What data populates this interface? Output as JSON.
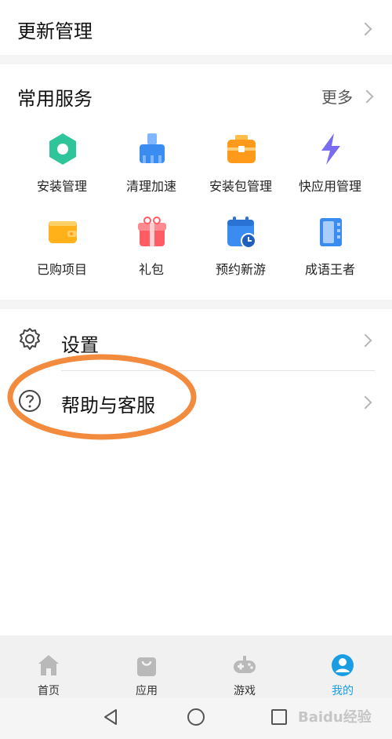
{
  "update": {
    "label": "更新管理"
  },
  "services": {
    "title": "常用服务",
    "more": "更多",
    "items": [
      {
        "label": "安装管理",
        "icon": "install-manage-icon",
        "color": "#2ec59a"
      },
      {
        "label": "清理加速",
        "icon": "broom-icon",
        "color": "#3b8cf0"
      },
      {
        "label": "安装包管理",
        "icon": "package-icon",
        "color": "#ff9a1a"
      },
      {
        "label": "快应用管理",
        "icon": "lightning-icon",
        "color": "#7a6cf0"
      },
      {
        "label": "已购项目",
        "icon": "wallet-icon",
        "color": "#ffb11a"
      },
      {
        "label": "礼包",
        "icon": "gift-icon",
        "color": "#ff5c63"
      },
      {
        "label": "预约新游",
        "icon": "calendar-icon",
        "color": "#3b8cf0"
      },
      {
        "label": "成语王者",
        "icon": "book-icon",
        "color": "#3b8cf0"
      }
    ]
  },
  "settings": {
    "label": "设置"
  },
  "help": {
    "label": "帮助与客服"
  },
  "tabbar": {
    "items": [
      {
        "label": "首页",
        "icon": "home-icon"
      },
      {
        "label": "应用",
        "icon": "bag-icon"
      },
      {
        "label": "游戏",
        "icon": "gamepad-icon"
      },
      {
        "label": "我的",
        "icon": "profile-icon"
      }
    ],
    "active_color": "#1a9de3"
  },
  "watermark": "Baidu经验"
}
